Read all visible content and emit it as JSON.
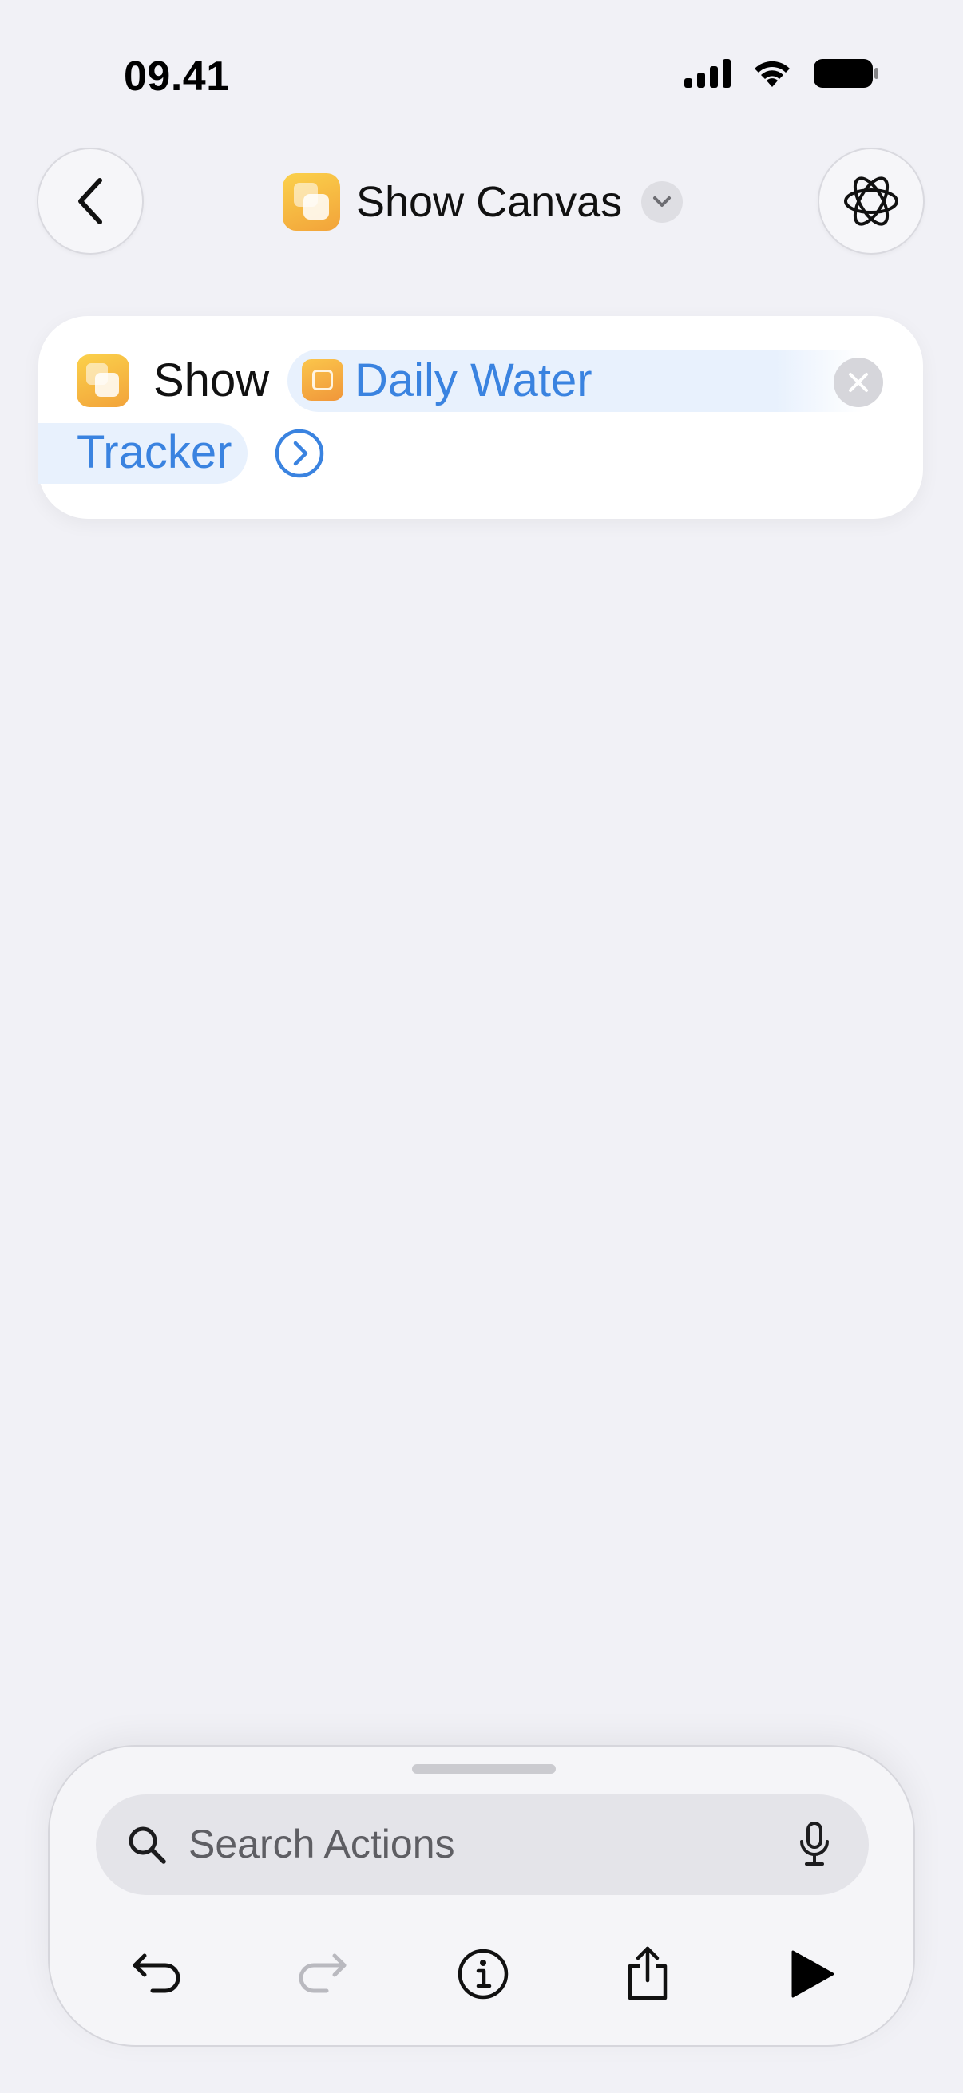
{
  "status_bar": {
    "time": "09.41"
  },
  "header": {
    "title": "Show Canvas",
    "back_icon": "chevron-left-icon",
    "menu_icon": "chevron-down-icon",
    "intelligence_icon": "apple-intelligence-icon"
  },
  "action": {
    "verb": "Show",
    "parameter": {
      "line1": "Daily Water",
      "line2": "Tracker"
    },
    "icon": "canvas-app-icon",
    "parameter_icon": "canvas-document-icon",
    "accent_color": "#3a83e0"
  },
  "search": {
    "placeholder": "Search Actions"
  },
  "toolbar": {
    "undo": "undo-icon",
    "redo": "redo-icon",
    "info": "info-icon",
    "share": "share-icon",
    "run": "play-icon"
  }
}
